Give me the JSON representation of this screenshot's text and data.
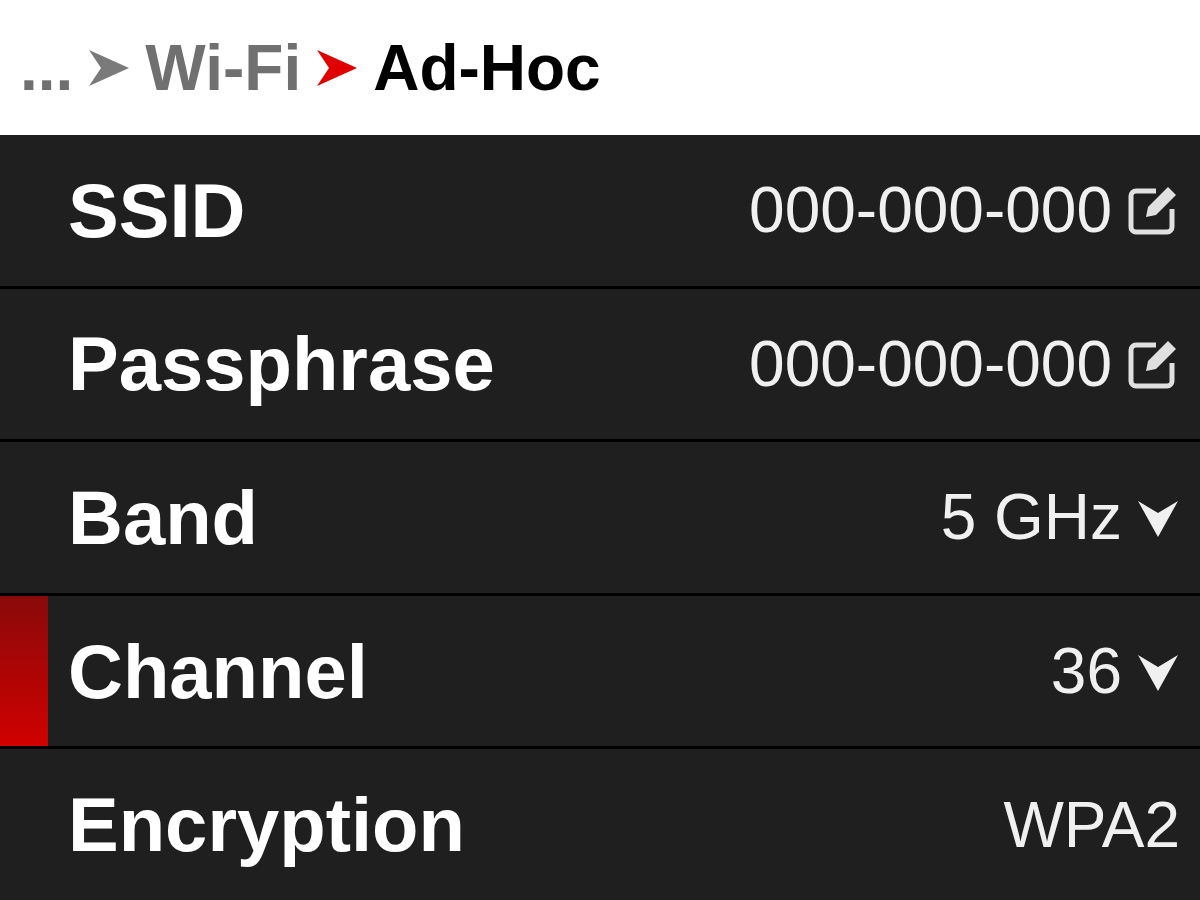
{
  "breadcrumb": [
    {
      "label": "...",
      "current": false
    },
    {
      "label": "Wi-Fi",
      "current": false
    },
    {
      "label": "Ad-Hoc",
      "current": true
    }
  ],
  "rows": [
    {
      "label": "SSID",
      "value": "000-000-000",
      "kind": "edit",
      "selected": false
    },
    {
      "label": "Passphrase",
      "value": "000-000-000",
      "kind": "edit",
      "selected": false
    },
    {
      "label": "Band",
      "value": "5 GHz",
      "kind": "dropdown",
      "selected": false
    },
    {
      "label": "Channel",
      "value": "36",
      "kind": "dropdown",
      "selected": true
    },
    {
      "label": "Encryption",
      "value": "WPA2",
      "kind": "plain",
      "selected": false
    }
  ]
}
